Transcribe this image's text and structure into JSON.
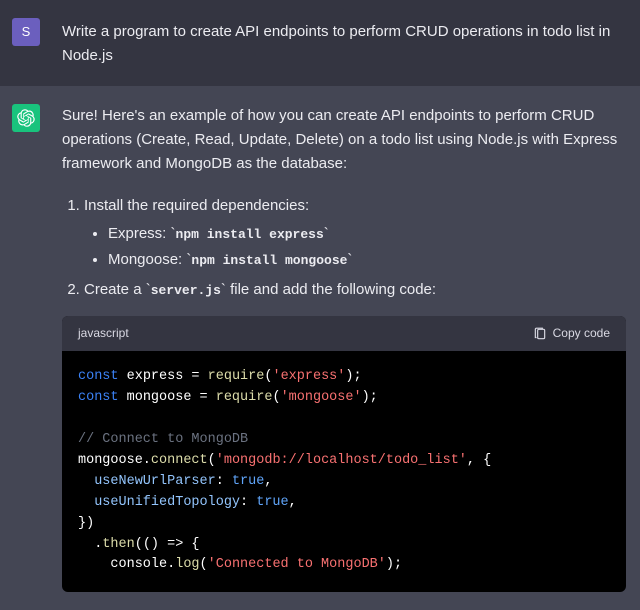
{
  "user": {
    "avatar_letter": "S",
    "message": "Write a program to create API endpoints to perform CRUD operations in todo list  in Node.js"
  },
  "assistant": {
    "intro": "Sure! Here's an example of how you can create API endpoints to perform CRUD operations (Create, Read, Update, Delete) on a todo list using Node.js with Express framework and MongoDB as the database:",
    "steps": {
      "step1_text": "Install the required dependencies:",
      "express_label": "Express: ",
      "express_cmd": "npm install express",
      "mongoose_label": "Mongoose: ",
      "mongoose_cmd": "npm install mongoose",
      "step2_prefix": "Create a ",
      "step2_filename": "server.js",
      "step2_suffix": " file and add the following code:"
    },
    "codeblock": {
      "language": "javascript",
      "copy_label": "Copy code",
      "code": {
        "l1_kw": "const",
        "l1_var": " express = ",
        "l1_fn": "require",
        "l1_paren_o": "(",
        "l1_str": "'express'",
        "l1_paren_c": ");",
        "l2_kw": "const",
        "l2_var": " mongoose = ",
        "l2_fn": "require",
        "l2_paren_o": "(",
        "l2_str": "'mongoose'",
        "l2_paren_c": ");",
        "l3_com": "// Connect to MongoDB",
        "l4_obj": "mongoose.",
        "l4_fn": "connect",
        "l4_paren_o": "(",
        "l4_str": "'mongodb://localhost/todo_list'",
        "l4_rest": ", {",
        "l5_prop": "useNewUrlParser",
        "l5_colon": ": ",
        "l5_bool": "true",
        "l5_comma": ",",
        "l6_prop": "useUnifiedTopology",
        "l6_colon": ": ",
        "l6_bool": "true",
        "l6_comma": ",",
        "l7": "})",
        "l8_dot": "  .",
        "l8_fn": "then",
        "l8_rest": "(() => {",
        "l9_pre": "    console.",
        "l9_fn": "log",
        "l9_paren_o": "(",
        "l9_str": "'Connected to MongoDB'",
        "l9_paren_c": ");"
      }
    }
  }
}
